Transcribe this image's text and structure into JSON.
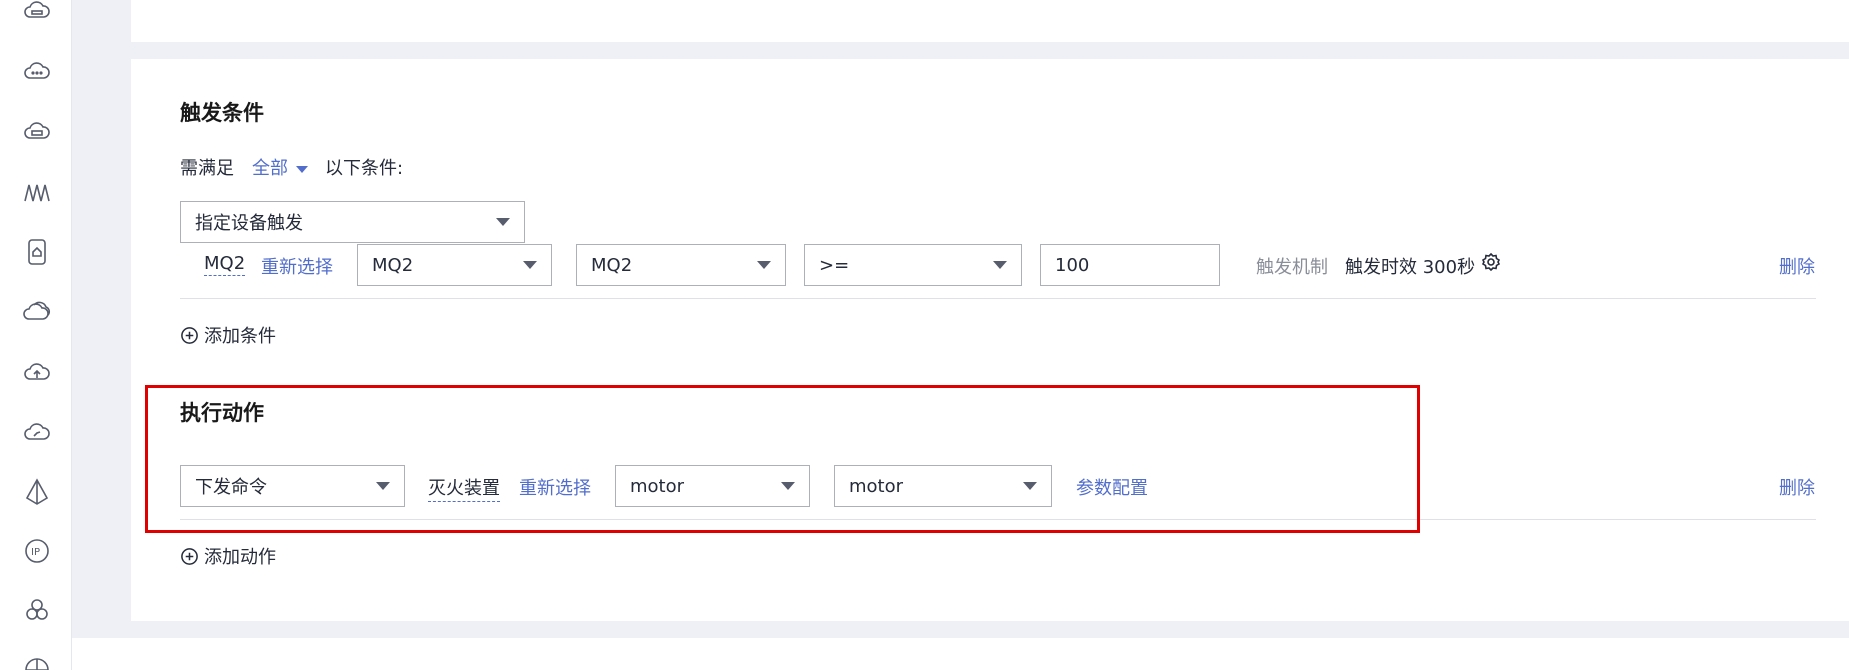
{
  "sidebar": {
    "icons": [
      "cloud-disk-icon",
      "cloud-more-icon",
      "cloud-server-icon",
      "waveform-icon",
      "device-card-icon",
      "cloud-stack-icon",
      "cloud-upload-icon",
      "cloud-analytics-icon",
      "cone-icon",
      "ip-icon",
      "cluster-icon",
      "globe-icon"
    ]
  },
  "trigger": {
    "title": "触发条件",
    "condition_prefix": "需满足",
    "condition_mode": "全部",
    "condition_suffix": "以下条件:",
    "trigger_type": "指定设备触发",
    "device_name": "MQ2",
    "reselect_label": "重新选择",
    "service_select": "MQ2",
    "property_select": "MQ2",
    "operator_select": ">=",
    "value_input": "100",
    "mechanism_label": "触发机制",
    "validity_label": "触发时效 300秒",
    "delete_label": "删除",
    "add_condition_label": "添加条件"
  },
  "action": {
    "title": "执行动作",
    "action_type": "下发命令",
    "device_name": "灭火装置",
    "reselect_label": "重新选择",
    "service_select": "motor",
    "command_select": "motor",
    "param_config_label": "参数配置",
    "delete_label": "删除",
    "add_action_label": "添加动作"
  },
  "colors": {
    "link": "#526ecc",
    "highlight": "#e00000",
    "background": "#eef0f5"
  }
}
